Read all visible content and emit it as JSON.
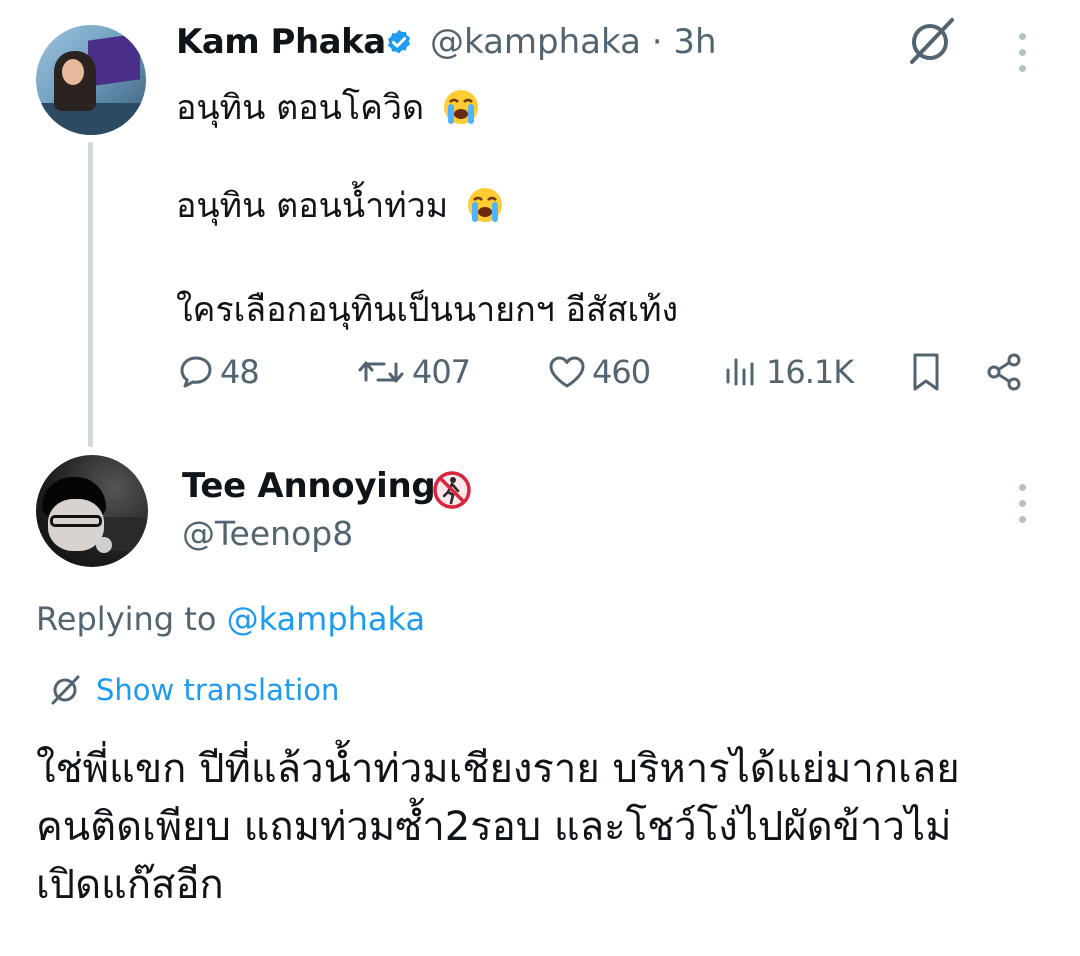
{
  "tweet": {
    "author_name": "Kam Phaka",
    "handle_time": "@kamphaka · 3h",
    "lines": [
      "อนุทิน ตอนโควิด",
      "อนุทิน ตอนน้ำท่วม",
      "ใครเลือกอนุทินเป็นนายกฯ อีสัสเท้ง"
    ],
    "emoji": "loudly-crying-face",
    "actions": {
      "replies": "48",
      "reposts": "407",
      "likes": "460",
      "views": "16.1K"
    }
  },
  "reply": {
    "author_name": "Tee Annoying",
    "badge_icon": "no-pedestrians-icon",
    "handle": "@Teenop8",
    "replying_prefix": "Replying to",
    "replying_to": "@kamphaka",
    "show_translation": "Show translation",
    "text_lines": [
      "ใช่พี่แขก ปีที่แล้วน้ำท่วมเชียงราย บริหารได้แย่มากเลย",
      "คนติดเพียบ แถมท่วมซ้ำ2รอบ และโชว์โง่ไปผัดข้าวไม่",
      "เปิดแก๊สอีก"
    ]
  },
  "colors": {
    "text_primary": "#0f1419",
    "text_secondary": "#536471",
    "link": "#1d9bf0",
    "verified": "#1d9bf0",
    "thread_line": "#cfd9de"
  }
}
